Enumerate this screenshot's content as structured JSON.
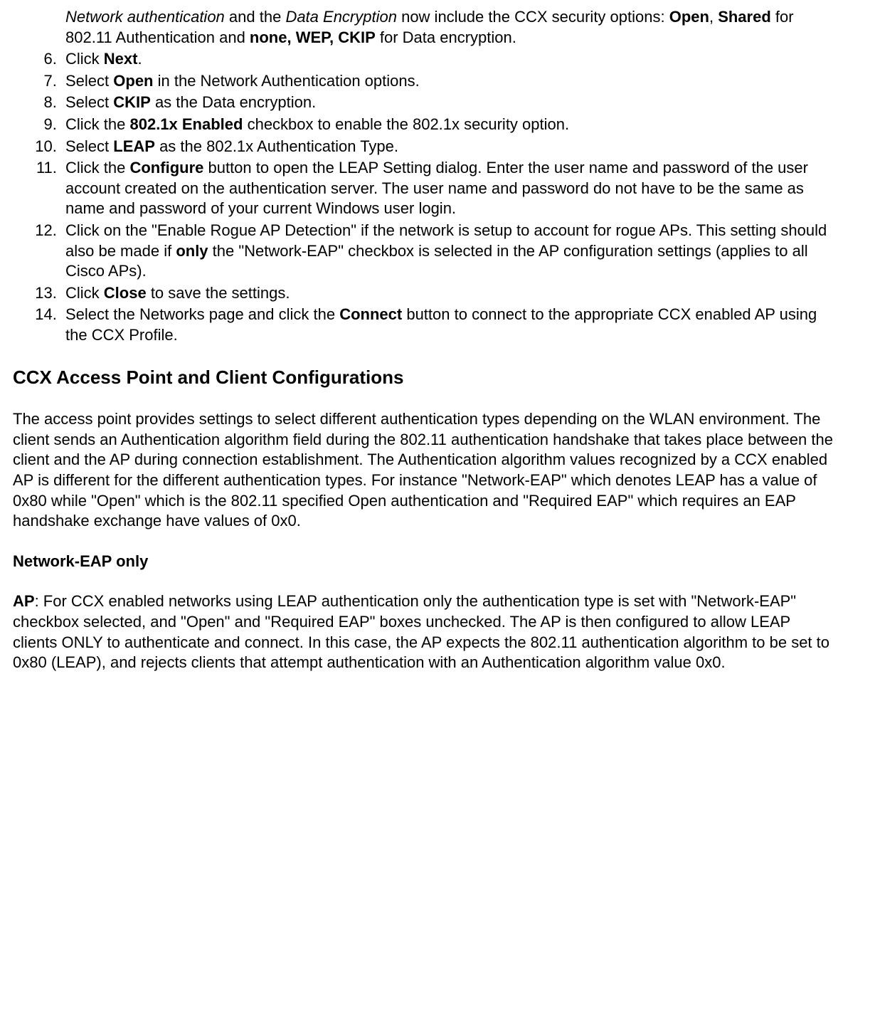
{
  "list": {
    "start": 6,
    "item5_pre": "Network authentication",
    "item5_and": " and the ",
    "item5_de": "Data Encryption",
    "item5_mid": " now include the CCX security options: ",
    "item5_open": "Open",
    "item5_comma1": ", ",
    "item5_shared": "Shared",
    "item5_mid2": " for 802.11 Authentication and ",
    "item5_none": "none, WEP, CKIP",
    "item5_end": " for Data encryption.",
    "item6_a": "Click ",
    "item6_b": "Next",
    "item6_c": ".",
    "item7_a": "Select ",
    "item7_b": "Open",
    "item7_c": " in the Network Authentication options.",
    "item8_a": "Select ",
    "item8_b": "CKIP",
    "item8_c": " as the Data encryption.",
    "item9_a": "Click the ",
    "item9_b": "802.1x Enabled",
    "item9_c": " checkbox to enable the 802.1x security option.",
    "item10_a": "Select ",
    "item10_b": "LEAP",
    "item10_c": " as the 802.1x Authentication Type.",
    "item11_a": "Click the ",
    "item11_b": "Configure",
    "item11_c": " button to open the LEAP Setting dialog. Enter the user name and password of the user account created on the authentication server. The user name and password do not have to be the same as name and password of your current Windows user login.",
    "item12_a": "Click on the \"Enable Rogue AP Detection\" if the network is setup to account for rogue APs. This setting should also be made if ",
    "item12_b": "only",
    "item12_c": " the \"Network-EAP\" checkbox is selected in the AP configuration settings (applies to all Cisco APs).",
    "item13_a": "Click ",
    "item13_b": "Close",
    "item13_c": " to save the settings.",
    "item14_a": "Select the Networks page and click the ",
    "item14_b": "Connect",
    "item14_c": " button to connect to the appropriate CCX enabled AP using the CCX Profile."
  },
  "h2": "CCX Access Point and Client Configurations",
  "p1": "The access point provides settings to select different authentication types depending on the WLAN environment. The client sends an Authentication algorithm field during the 802.11 authentication handshake that takes place between the client and the AP during connection establishment. The Authentication algorithm values recognized by a CCX enabled AP is different for the different authentication types. For instance \"Network-EAP\" which denotes LEAP has a value of 0x80 while \"Open\" which is the 802.11 specified Open authentication and \"Required EAP\" which requires an EAP handshake exchange have values of 0x0.",
  "h3": "Network-EAP only",
  "p2_a": "AP",
  "p2_b": ": For CCX enabled networks using LEAP authentication only the authentication type is set with \"Network-EAP\" checkbox selected, and \"Open\" and \"Required EAP\" boxes unchecked. The AP is then configured to allow LEAP clients ONLY to authenticate and connect. In this case, the AP expects the 802.11 authentication algorithm to be set to 0x80 (LEAP), and rejects clients that attempt authentication with an Authentication algorithm value 0x0."
}
